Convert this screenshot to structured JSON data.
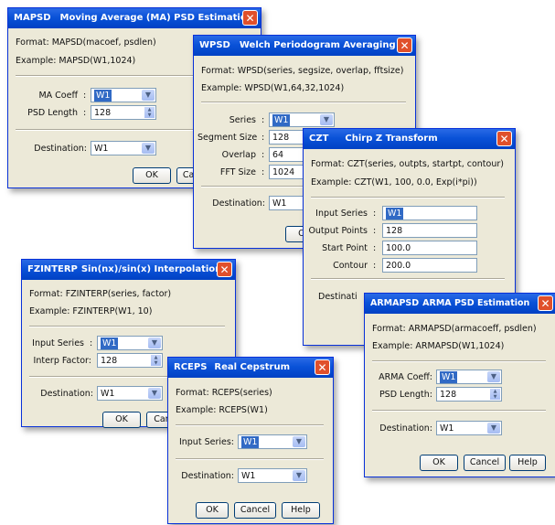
{
  "mapsd": {
    "title_short": "MAPSD",
    "title_long": "Moving Average (MA) PSD Estimation",
    "format": "Format:  MAPSD(macoef, psdlen)",
    "example": "Example: MAPSD(W1,1024)",
    "coef_label": "MA Coeff",
    "coef_value": "W1",
    "len_label": "PSD Length",
    "len_value": "128",
    "dest_label": "Destination:",
    "dest_value": "W1",
    "ok": "OK",
    "cancel": "Cancel"
  },
  "wpsd": {
    "title_short": "WPSD",
    "title_long": "Welch Periodogram Averaging",
    "format": "Format:  WPSD(series, segsize, overlap, fftsize)",
    "example": "Example: WPSD(W1,64,32,1024)",
    "series_label": "Series",
    "series_value": "W1",
    "segsize_label": "Segment Size",
    "segsize_value": "128",
    "overlap_label": "Overlap",
    "overlap_value": "64",
    "fft_label": "FFT Size",
    "fft_value": "1024",
    "dest_label": "Destination:",
    "dest_value": "W1",
    "ok": "OK"
  },
  "czt": {
    "title_short": "CZT",
    "title_long": "Chirp Z Transform",
    "format": "Format:  CZT(series, outpts, startpt, contour)",
    "example": "Example:  CZT(W1, 100, 0.0, Exp(i*pi))",
    "input_label": "Input Series",
    "input_value": "W1",
    "outpts_label": "Output Points",
    "outpts_value": "128",
    "start_label": "Start Point",
    "start_value": "100.0",
    "contour_label": "Contour",
    "contour_value": "200.0",
    "dest_label": "Destinati"
  },
  "fzinterp": {
    "title_short": "FZINTERP",
    "title_long": "Sin(nx)/sin(x) Interpolation",
    "format": "Format:  FZINTERP(series, factor)",
    "example": "Example:  FZINTERP(W1, 10)",
    "input_label": "Input Series",
    "input_value": "W1",
    "factor_label": "Interp Factor:",
    "factor_value": "128",
    "dest_label": "Destination:",
    "dest_value": "W1",
    "ok": "OK",
    "cancel": "Cance"
  },
  "rceps": {
    "title_short": "RCEPS",
    "title_long": "Real Cepstrum",
    "format": "Format:  RCEPS(series)",
    "example": "Example:  RCEPS(W1)",
    "input_label": "Input Series:",
    "input_value": "W1",
    "dest_label": "Destination:",
    "dest_value": "W1",
    "ok": "OK",
    "cancel": "Cancel",
    "help": "Help"
  },
  "armapsd": {
    "title_short": "ARMAPSD",
    "title_long": "ARMA PSD Estimation",
    "format": "Format:  ARMAPSD(armacoeff, psdlen)",
    "example": "Example:  ARMAPSD(W1,1024)",
    "coef_label": "ARMA Coeff:",
    "coef_value": "W1",
    "len_label": "PSD Length:",
    "len_value": "128",
    "dest_label": "Destination:",
    "dest_value": "W1",
    "ok": "OK",
    "cancel": "Cancel",
    "help": "Help"
  },
  "colors": {
    "titlebar": "#0a52d8",
    "close": "#e0502b",
    "dialog": "#ece9d8",
    "selection": "#316ac5"
  }
}
